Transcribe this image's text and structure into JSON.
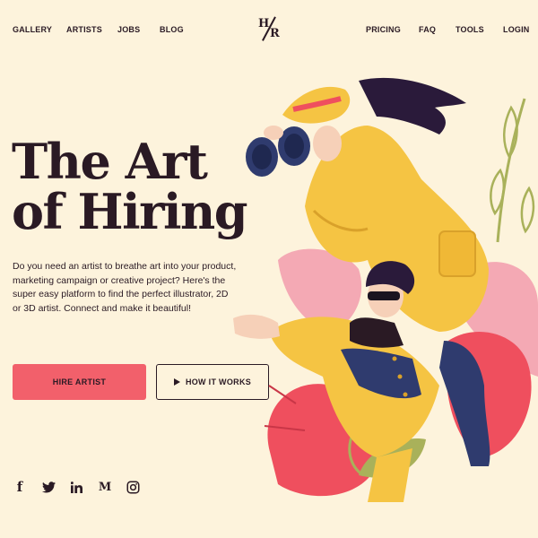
{
  "nav": {
    "left": [
      "GALLERY",
      "ARTISTS",
      "JOBS",
      "BLOG"
    ],
    "right": [
      "PRICING",
      "FAQ",
      "TOOLS",
      "LOGIN"
    ]
  },
  "logo": {
    "top": "H",
    "bottom": "R"
  },
  "hero": {
    "title_line1": "The Art",
    "title_line2": "of Hiring",
    "description": "Do you need an artist to breathe art into your product, marketing campaign or creative project? Here's the super easy platform to find the perfect illustrator, 2D or 3D artist. Connect and make it beautiful!",
    "primary_button": "HIRE ARTIST",
    "secondary_button": "HOW IT WORKS"
  },
  "social": {
    "facebook": "f",
    "medium": "M"
  },
  "colors": {
    "background": "#fdf3dc",
    "text": "#2a1a24",
    "accent": "#f2606b",
    "coat": "#f5c443"
  },
  "icons": [
    "facebook-icon",
    "twitter-icon",
    "linkedin-icon",
    "medium-icon",
    "instagram-icon",
    "play-icon"
  ]
}
